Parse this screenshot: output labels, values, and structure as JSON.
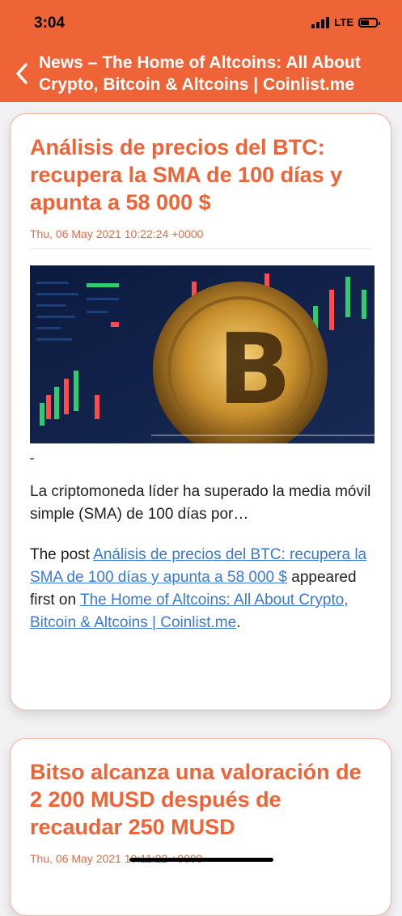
{
  "status": {
    "time": "3:04",
    "network": "LTE"
  },
  "header": {
    "title": "News – The Home of Altcoins: All About Crypto, Bitcoin & Altcoins | Coinlist.me"
  },
  "articles": [
    {
      "title": "Análisis de precios del BTC: recupera la SMA de 100 días y apunta a 58 000 $",
      "date": "Thu, 06 May 2021 10:22:24 +0000",
      "excerpt": "La criptomoneda líder ha superado la media móvil simple (SMA) de 100 días por…",
      "post_prefix": "The post ",
      "post_link": "Análisis de precios del BTC: recupera la SMA de 100 días y apunta a 58 000 $",
      "post_middle": " appeared first on ",
      "site_link": "The Home of Altcoins: All About Crypto, Bitcoin & Altcoins | Coinlist.me",
      "post_suffix": "."
    },
    {
      "title": "Bitso alcanza una valoración de 2 200 MUSD después de recaudar 250 MUSD",
      "date": "Thu, 06 May 2021 10:11:22 +0000"
    }
  ]
}
